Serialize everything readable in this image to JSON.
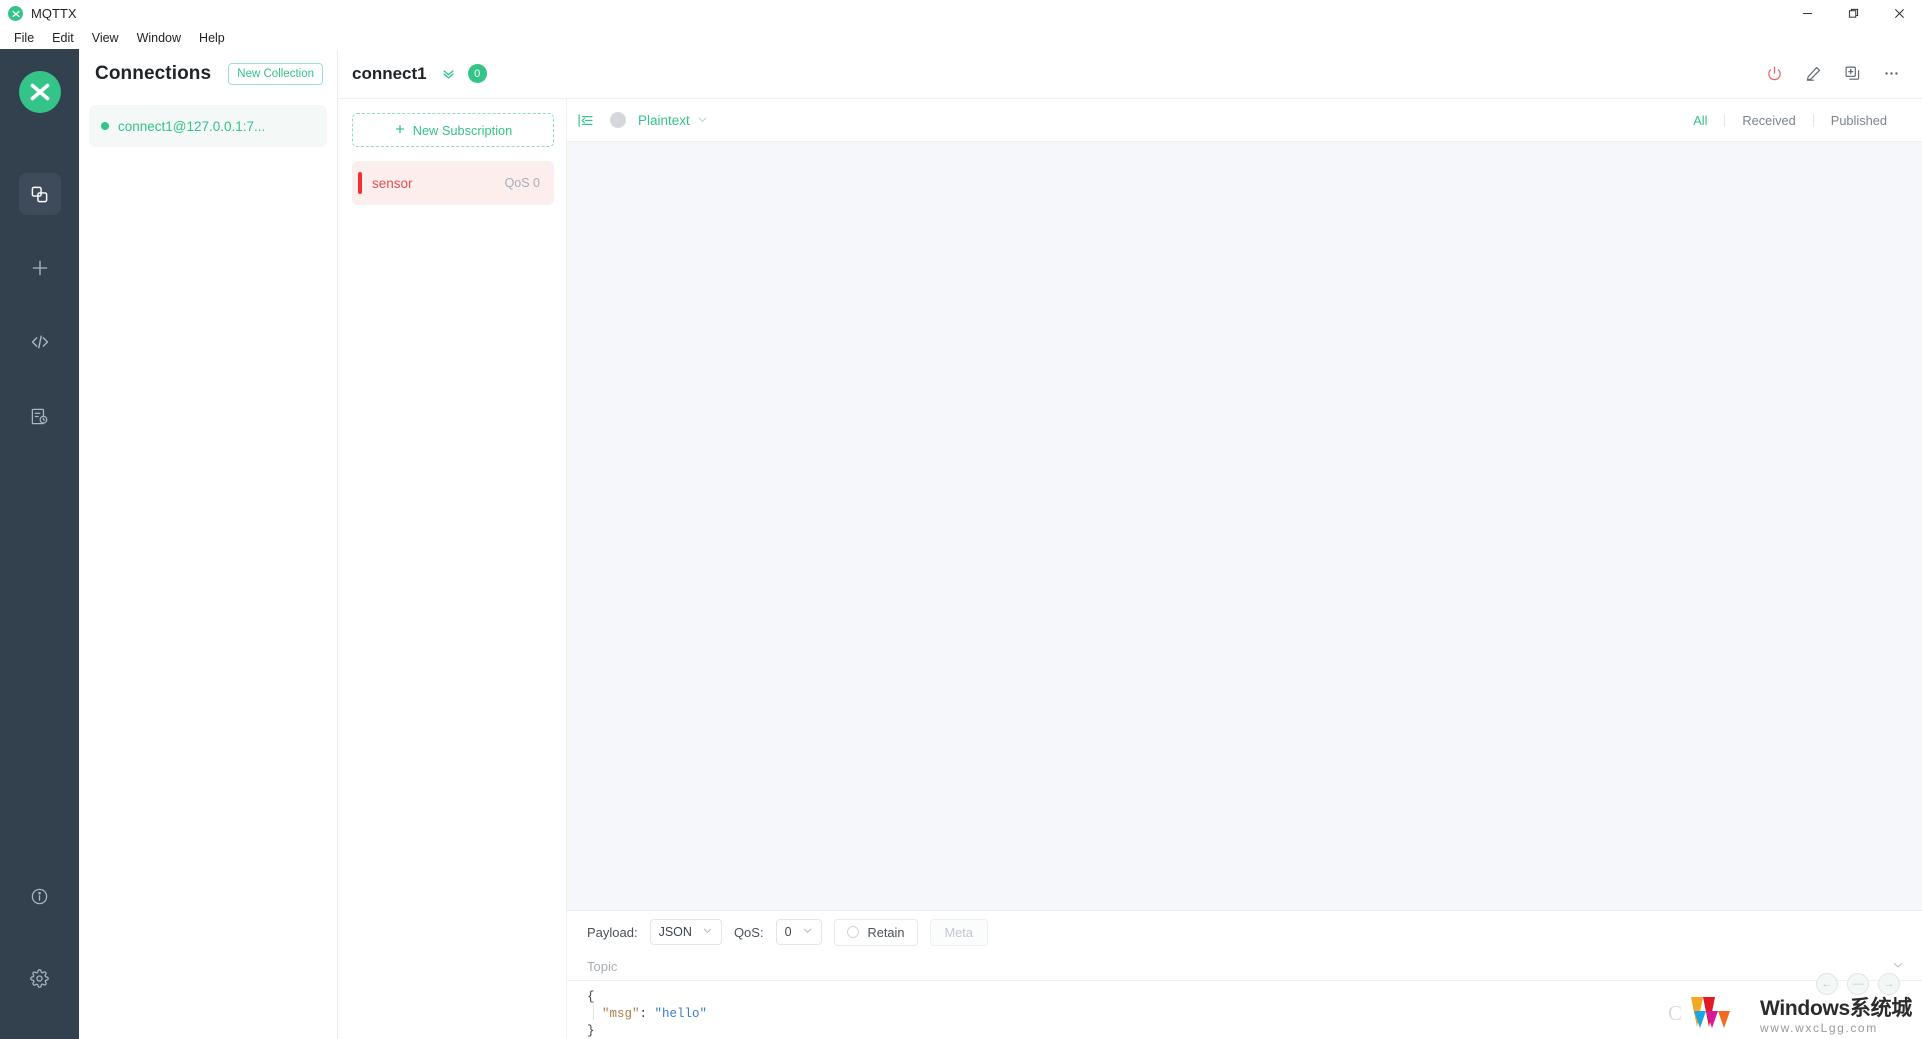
{
  "window": {
    "app_name": "MQTTX",
    "logo_icon": "mqttx-logo-icon",
    "minimize": "—",
    "maximize": "❐",
    "close": "✕"
  },
  "menubar": {
    "items": [
      {
        "label": "File"
      },
      {
        "label": "Edit"
      },
      {
        "label": "View"
      },
      {
        "label": "Window"
      },
      {
        "label": "Help"
      }
    ]
  },
  "rail": {
    "logo_icon": "mqttx-logo-icon",
    "items": [
      {
        "name": "connections-icon",
        "active": true
      },
      {
        "name": "new-connection-plus-icon",
        "active": false
      },
      {
        "name": "code-script-icon",
        "active": false
      },
      {
        "name": "log-viewer-icon",
        "active": false
      }
    ],
    "bottom_items": [
      {
        "name": "info-icon"
      },
      {
        "name": "settings-gear-icon"
      }
    ]
  },
  "connections": {
    "title": "Connections",
    "new_collection_label": "New Collection",
    "items": [
      {
        "label": "connect1@127.0.0.1:7...",
        "status": "connected",
        "status_color": "#34c388"
      }
    ]
  },
  "connection_header": {
    "name": "connect1",
    "chevron_icon": "double-chevron-down-icon",
    "message_count": "0",
    "actions": [
      {
        "name": "disconnect-power-icon",
        "color": "#e8606d"
      },
      {
        "name": "edit-pencil-icon",
        "color": "#5c6670"
      },
      {
        "name": "duplicate-connection-icon",
        "color": "#5c6670"
      },
      {
        "name": "more-options-icon",
        "color": "#5c6670"
      }
    ]
  },
  "subscriptions": {
    "new_subscription_label": "New Subscription",
    "plus_icon": "plus-icon",
    "items": [
      {
        "topic": "sensor",
        "qos": "QoS 0",
        "color": "#e45050",
        "bar_color": "#f23030"
      }
    ]
  },
  "messages": {
    "collapse_icon": "collapse-panel-icon",
    "avatar_icon": "avatar-icon",
    "format": "Plaintext",
    "format_chevron": "chevron-down-icon",
    "filters": [
      {
        "label": "All",
        "active": true
      },
      {
        "label": "Received",
        "active": false
      },
      {
        "label": "Published",
        "active": false
      }
    ],
    "list": []
  },
  "publish": {
    "payload_label": "Payload:",
    "payload_value": "JSON",
    "qos_label": "QoS:",
    "qos_value": "0",
    "retain_label": "Retain",
    "retain_checked": false,
    "meta_label": "Meta",
    "topic_placeholder": "Topic",
    "topic_value": "",
    "editor": {
      "lines": [
        {
          "open_brace": "{"
        },
        {
          "key": "\"msg\"",
          "colon": ": ",
          "value": "\"hello\""
        },
        {
          "close_brace": "}"
        }
      ]
    },
    "buttons": [
      {
        "name": "prev-message-button",
        "glyph": "←"
      },
      {
        "name": "clear-button",
        "glyph": "—"
      },
      {
        "name": "send-message-button",
        "glyph": "→"
      }
    ]
  },
  "watermark": {
    "mark": "C",
    "title": "Windows系统城",
    "url": "www.wxcLgg.com"
  },
  "theme": {
    "accent": "#34c388",
    "rail_bg": "#33414f",
    "message_bg": "#f6f7fa",
    "danger": "#e8606d"
  }
}
